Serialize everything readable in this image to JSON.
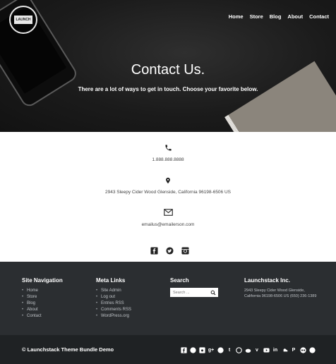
{
  "nav": {
    "items": [
      "Home",
      "Store",
      "Blog",
      "About",
      "Contact"
    ]
  },
  "hero": {
    "title": "Contact Us.",
    "subtitle": "There are a lot of ways to get in touch. Choose your favorite below."
  },
  "contact": {
    "phone": "1.888.888.8888",
    "address": "2943 Sleepy Cider Wood Glenside, California 96198-6506 US",
    "email": "emailus@emailerson.com"
  },
  "footer": {
    "site_navigation": {
      "heading": "Site Navigation",
      "links": [
        "Home",
        "Store",
        "Blog",
        "About",
        "Contact"
      ]
    },
    "meta_links": {
      "heading": "Meta Links",
      "links": [
        "Site Admin",
        "Log out",
        "Entries RSS",
        "Comments RSS",
        "WordPress.org"
      ]
    },
    "search": {
      "heading": "Search",
      "placeholder": "Search ..."
    },
    "company": {
      "heading": "Launchstack Inc.",
      "address": "2943 Sleepy Cider Wood Glenside, California 96198-6506 US (650) 236-1389"
    },
    "copyright": "© Launchstack Theme Bundle Demo"
  },
  "colors": {
    "hero_bg": "#1c1c1c",
    "footer_top": "#2b2e31",
    "footer_bottom": "#1f2224"
  }
}
